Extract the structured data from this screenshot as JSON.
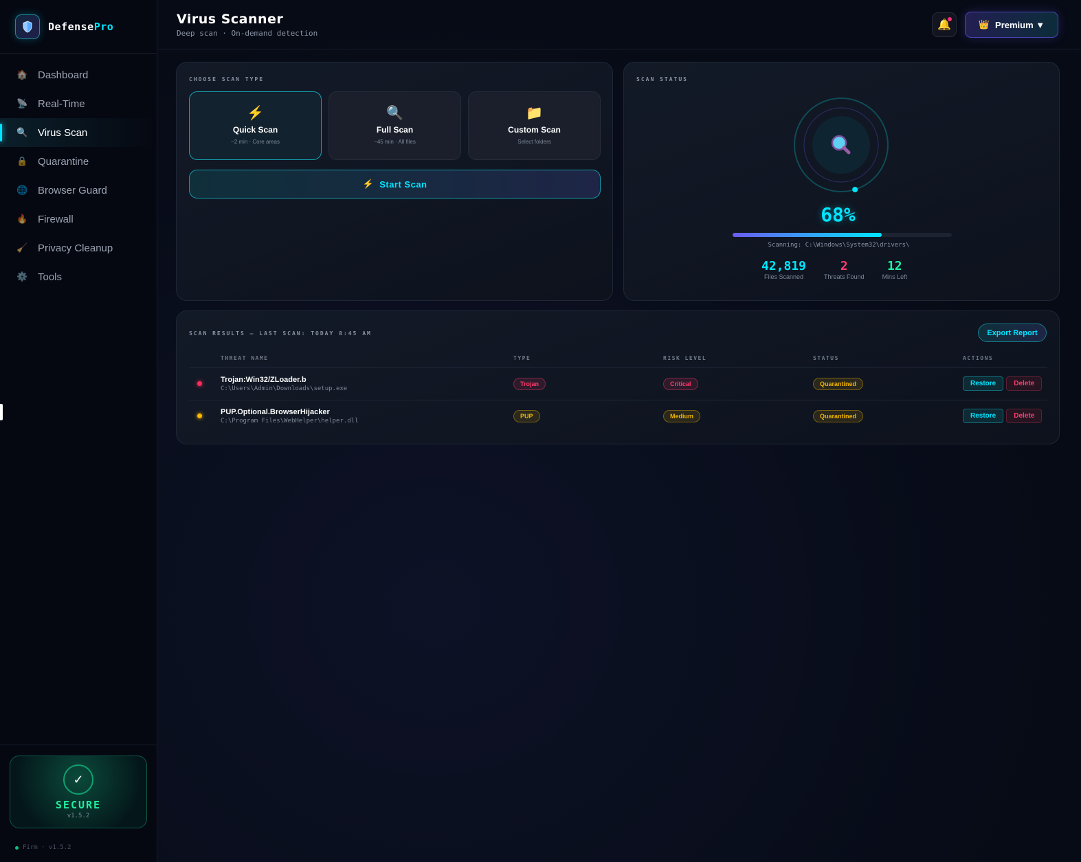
{
  "brand": {
    "name_a": "Defense",
    "name_b": "Pro"
  },
  "sidebar": {
    "items": [
      {
        "label": "Dashboard",
        "icon": "🏠",
        "name": "house-icon"
      },
      {
        "label": "Real-Time",
        "icon": "📡",
        "name": "satellite-icon"
      },
      {
        "label": "Virus Scan",
        "icon": "🔍",
        "name": "magnifier-icon",
        "active": true
      },
      {
        "label": "Quarantine",
        "icon": "🔒",
        "name": "lock-icon"
      },
      {
        "label": "Browser Guard",
        "icon": "🌐",
        "name": "globe-icon"
      },
      {
        "label": "Firewall",
        "icon": "🔥",
        "name": "fire-icon"
      },
      {
        "label": "Privacy Cleanup",
        "icon": "🧹",
        "name": "broom-icon"
      },
      {
        "label": "Tools",
        "icon": "⚙️",
        "name": "gear-icon"
      }
    ],
    "status": {
      "check": "✓",
      "label": "SECURE",
      "version": "v1.5.2"
    },
    "footer": "Firm · v1.5.2"
  },
  "header": {
    "title": "Virus Scanner",
    "subtitle": "Deep scan · On-demand detection",
    "plan": "Premium ▼",
    "plan_icon": "👑"
  },
  "scan_type": {
    "label": "CHOOSE SCAN TYPE",
    "options": [
      {
        "icon": "⚡",
        "name": "Quick Scan",
        "desc": "~2 min · Core areas",
        "selected": true
      },
      {
        "icon": "🔍",
        "name": "Full Scan",
        "desc": "~45 min · All files"
      },
      {
        "icon": "📁",
        "name": "Custom Scan",
        "desc": "Select folders"
      }
    ],
    "start_icon": "⚡",
    "start_label": "Start Scan"
  },
  "scan_status": {
    "label": "SCAN STATUS",
    "percent_text": "68%",
    "progress": 0.68,
    "scanning": "Scanning: C:\\Windows\\System32\\drivers\\",
    "stats": [
      {
        "value": "42,819",
        "label": "Files Scanned",
        "color": "#00e5ff"
      },
      {
        "value": "2",
        "label": "Threats Found",
        "color": "#ff3d6e"
      },
      {
        "value": "12",
        "label": "Mins Left",
        "color": "#1ef0a0"
      }
    ]
  },
  "results": {
    "label": "SCAN RESULTS — LAST SCAN: TODAY 8:45 AM",
    "export": "Export Report",
    "columns": [
      "",
      "THREAT NAME",
      "TYPE",
      "RISK LEVEL",
      "STATUS",
      "ACTIONS"
    ],
    "rows": [
      {
        "dot": "#ff2d5a",
        "name": "Trojan:Win32/ZLoader.b",
        "path": "C:\\Users\\Admin\\Downloads\\setup.exe",
        "type": "Trojan",
        "type_color": "#ff3d6e",
        "risk": "Critical",
        "risk_color": "#ff3d6e",
        "status": "Quarantined",
        "restore": "Restore",
        "delete": "Delete"
      },
      {
        "dot": "#ffb800",
        "name": "PUP.Optional.BrowserHijacker",
        "path": "C:\\Program Files\\WebHelper\\helper.dll",
        "type": "PUP",
        "type_color": "#f0b400",
        "risk": "Medium",
        "risk_color": "#f0b400",
        "status": "Quarantined",
        "restore": "Restore",
        "delete": "Delete"
      }
    ]
  }
}
